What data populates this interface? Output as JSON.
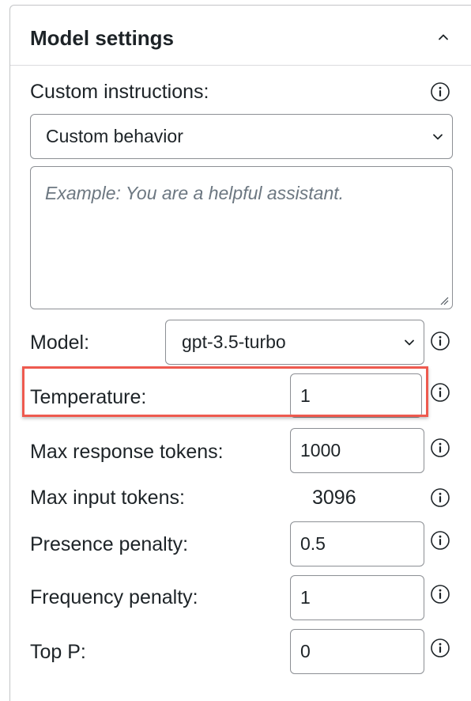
{
  "panel": {
    "title": "Model settings",
    "collapse_icon": "chevron-up-icon"
  },
  "custom_instructions": {
    "label": "Custom instructions:",
    "selected": "Custom behavior",
    "textarea_placeholder": "Example: You are a helpful assistant."
  },
  "model": {
    "label": "Model:",
    "selected": "gpt-3.5-turbo"
  },
  "temperature": {
    "label": "Temperature:",
    "value": "1"
  },
  "max_response_tokens": {
    "label": "Max response tokens:",
    "value": "1000"
  },
  "max_input_tokens": {
    "label": "Max input tokens:",
    "value": "3096"
  },
  "presence_penalty": {
    "label": "Presence penalty:",
    "value": "0.5"
  },
  "frequency_penalty": {
    "label": "Frequency penalty:",
    "value": "1"
  },
  "top_p": {
    "label": "Top P:",
    "value": "0"
  },
  "colors": {
    "highlight": "#ee5a4f",
    "border": "#8c8f94",
    "text": "#1d2327",
    "placeholder": "#6c7781"
  },
  "icons": {
    "info": "info-icon",
    "dropdown": "chevron-down-icon"
  }
}
